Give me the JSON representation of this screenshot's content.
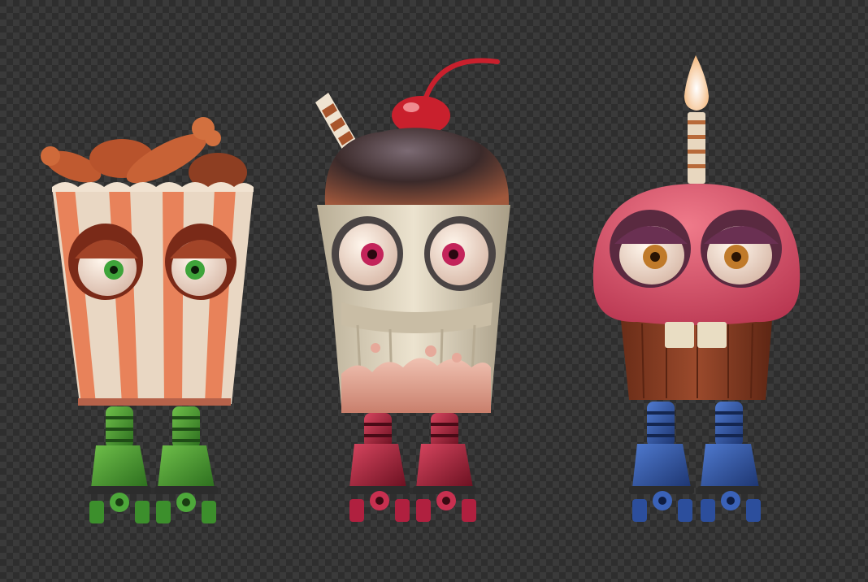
{
  "scene": {
    "background": "transparency-checkerboard",
    "colors": {
      "checker_dark": "#2e2e2e",
      "checker_light": "#3a3a3a"
    },
    "characters": [
      {
        "id": "chicken-bucket",
        "body_colors": {
          "stripe_a": "#e8825a",
          "stripe_b": "#e9d7c3",
          "food": "#c45e33"
        },
        "eye_color": "#3fa43a",
        "skate_color": "#3c8f2c"
      },
      {
        "id": "milkshake",
        "body_colors": {
          "cup": "#d8cdb6",
          "topping": "#3b2a2a",
          "cherry": "#c9202d",
          "drip": "#e6a99a"
        },
        "eye_color": "#c3245a",
        "skate_color": "#b0203f"
      },
      {
        "id": "cupcake",
        "body_colors": {
          "frosting": "#e0556a",
          "wrapper": "#8a3f26",
          "candle": "#e8d7bf",
          "flame": "#fff2d6"
        },
        "eye_color": "#c07a2a",
        "skate_color": "#2c4e9c"
      }
    ]
  }
}
